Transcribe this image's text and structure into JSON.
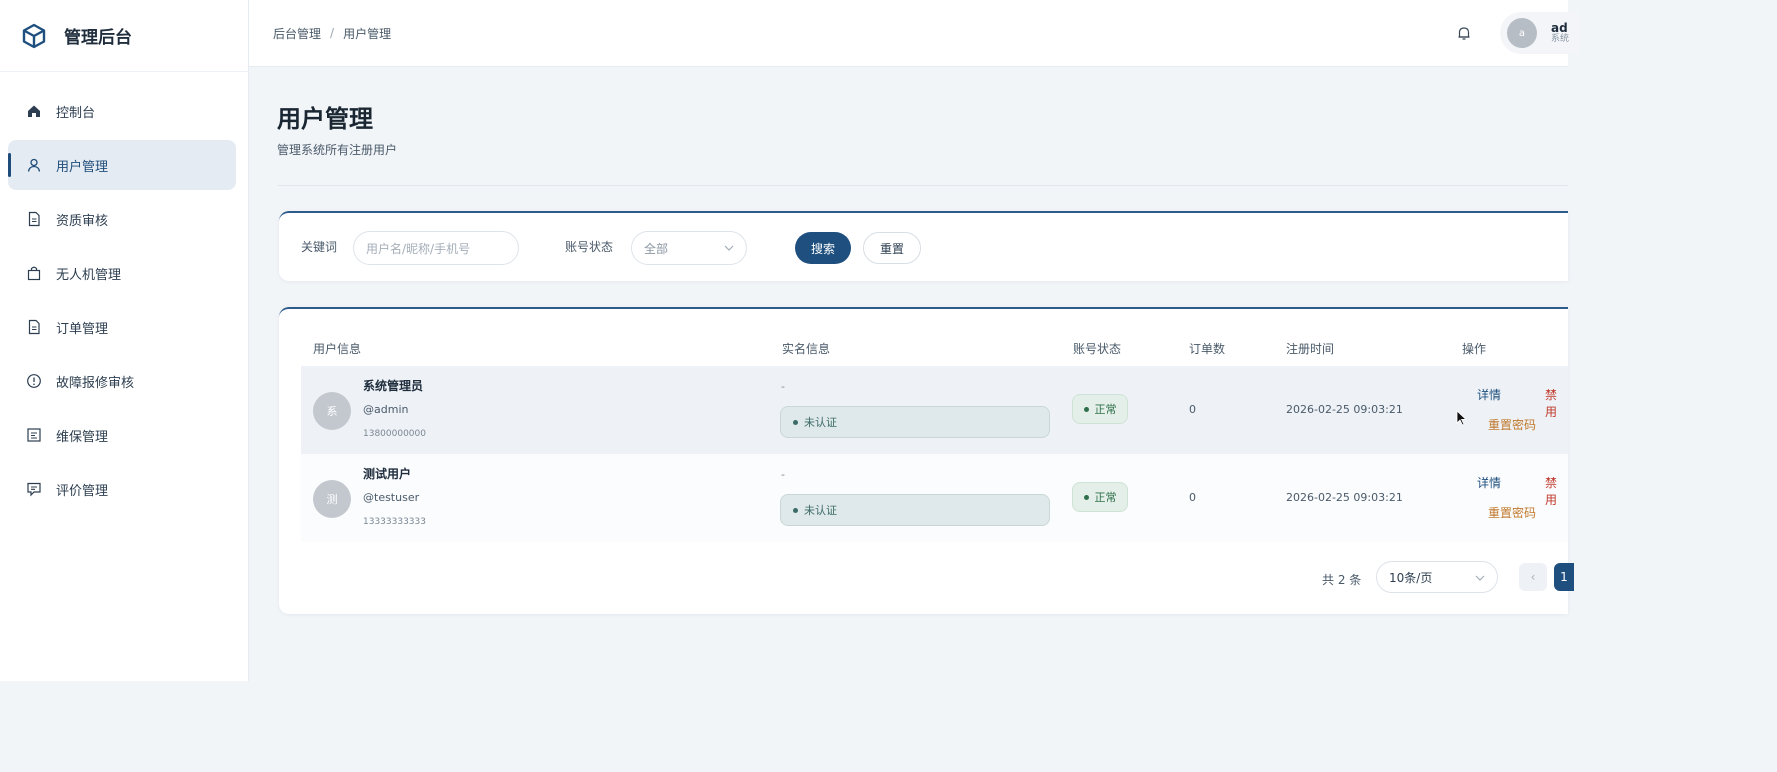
{
  "sidebar": {
    "brand": "管理后台",
    "items": [
      {
        "label": "控制台",
        "icon": "home-icon"
      },
      {
        "label": "用户管理",
        "icon": "user-icon",
        "active": true
      },
      {
        "label": "资质审核",
        "icon": "document-icon"
      },
      {
        "label": "无人机管理",
        "icon": "bag-icon"
      },
      {
        "label": "订单管理",
        "icon": "document-icon"
      },
      {
        "label": "故障报修审核",
        "icon": "alert-circle-icon"
      },
      {
        "label": "维保管理",
        "icon": "maintenance-icon"
      },
      {
        "label": "评价管理",
        "icon": "message-icon"
      }
    ]
  },
  "header": {
    "breadcrumb": [
      "后台管理",
      "用户管理"
    ],
    "user": {
      "avatar": "a",
      "name": "ad",
      "role": "系统"
    }
  },
  "page": {
    "title": "用户管理",
    "subtitle": "管理系统所有注册用户"
  },
  "filters": {
    "keyword_label": "关键词",
    "keyword_placeholder": "用户名/昵称/手机号",
    "status_label": "账号状态",
    "status_value": "全部",
    "search_label": "搜索",
    "reset_label": "重置"
  },
  "table": {
    "columns": [
      "用户信息",
      "实名信息",
      "账号状态",
      "订单数",
      "注册时间",
      "操作"
    ],
    "rows": [
      {
        "avatar": "系",
        "name": "系统管理员",
        "handle": "@admin",
        "phone": "13800000000",
        "realname": "-",
        "verify": "未认证",
        "status": "正常",
        "orders": "0",
        "registered": "2026-02-25 09:03:21",
        "actions": {
          "detail": "详情",
          "disable": "禁用",
          "reset": "重置密码"
        }
      },
      {
        "avatar": "测",
        "name": "测试用户",
        "handle": "@testuser",
        "phone": "13333333333",
        "realname": "-",
        "verify": "未认证",
        "status": "正常",
        "orders": "0",
        "registered": "2026-02-25 09:03:21",
        "actions": {
          "detail": "详情",
          "disable": "禁用",
          "reset": "重置密码"
        }
      }
    ]
  },
  "pagination": {
    "total": "共 2 条",
    "page_size": "10条/页",
    "prev": "‹",
    "current": "1"
  },
  "colors": {
    "primary": "#1f4f7f",
    "danger": "#c0392b",
    "warning": "#c0782b",
    "success": "#2f6f4a"
  }
}
